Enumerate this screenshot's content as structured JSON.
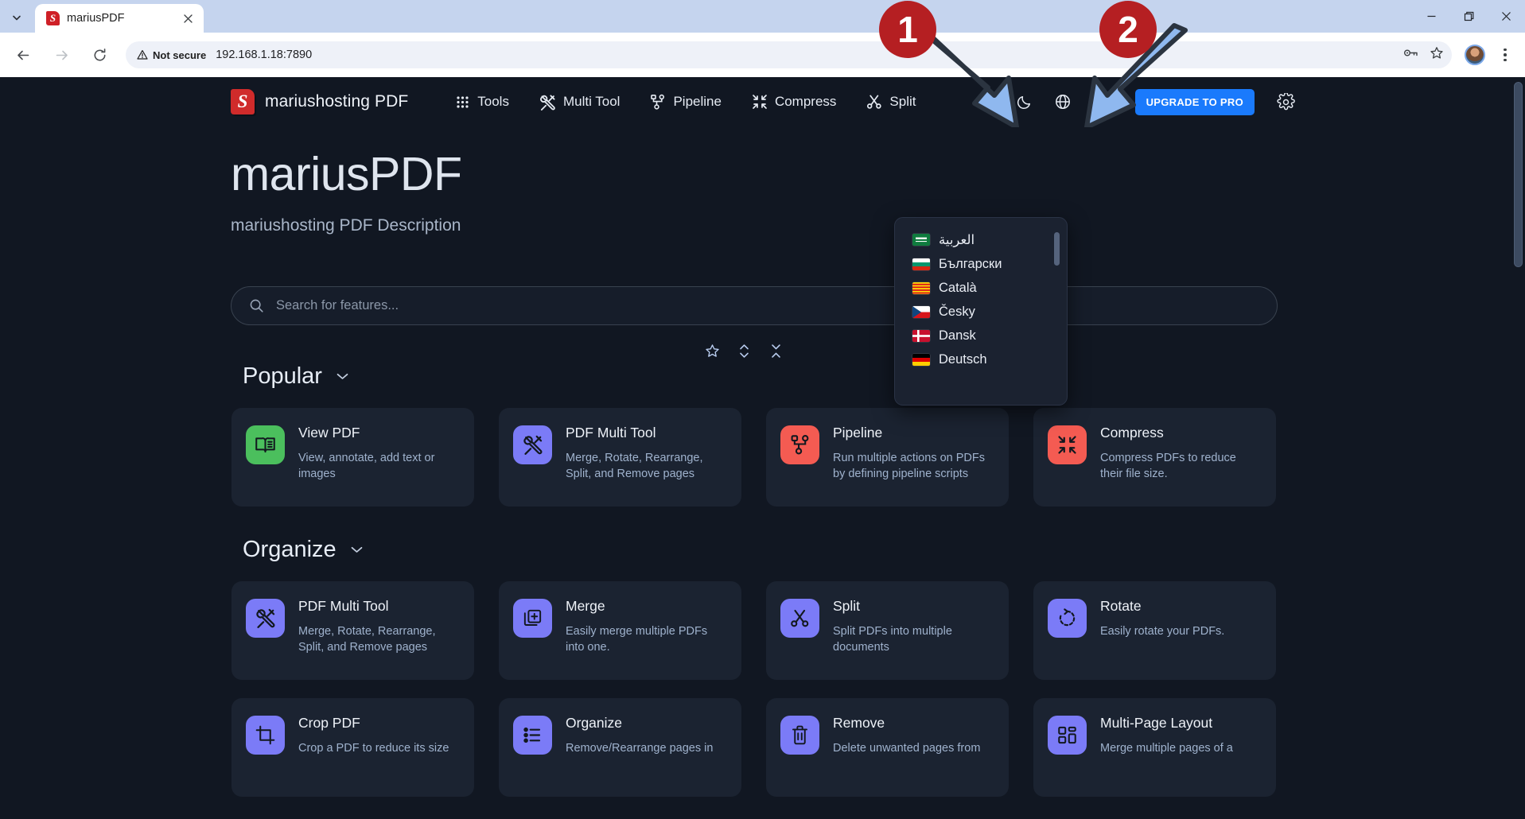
{
  "browser": {
    "tab": {
      "title": "mariusPDF",
      "favicon": "stirling-s-icon",
      "close_icon": "close-icon"
    },
    "tab_list_icon": "chevron-down-icon",
    "back_icon": "back-arrow-icon",
    "forward_icon": "forward-arrow-icon",
    "reload_icon": "reload-icon",
    "security": {
      "label": "Not secure",
      "icon": "warning-triangle-icon"
    },
    "url": "192.168.1.18:7890",
    "omnibox_icons": [
      "password-key-icon",
      "bookmark-star-icon"
    ],
    "profile_icon": "avatar",
    "menu_icon": "kebab-menu-icon",
    "window": {
      "minimize": "minimize-icon",
      "restore": "restore-icon",
      "close": "close-icon"
    }
  },
  "app": {
    "brand": {
      "name": "mariushosting PDF",
      "logo": "stirling-s-logo"
    },
    "nav": [
      {
        "label": "Tools",
        "icon": "grid-dots-icon"
      },
      {
        "label": "Multi Tool",
        "icon": "tools-hammer-wrench-icon"
      },
      {
        "label": "Pipeline",
        "icon": "pipeline-nodes-icon"
      },
      {
        "label": "Compress",
        "icon": "compress-arrows-icon"
      },
      {
        "label": "Split",
        "icon": "scissors-icon"
      }
    ],
    "actions": {
      "favorites_icon": "star-icon",
      "dark_mode_icon": "moon-icon",
      "language_icon": "globe-icon",
      "search_icon": "search-icon",
      "upgrade_label": "UPGRADE TO PRO",
      "settings_icon": "gear-icon"
    }
  },
  "language_menu": {
    "visible": true,
    "items": [
      {
        "label": "العربية",
        "flag": "sa",
        "rtl": true
      },
      {
        "label": "Български",
        "flag": "bg",
        "rtl": false
      },
      {
        "label": "Català",
        "flag": "cat",
        "rtl": false
      },
      {
        "label": "Česky",
        "flag": "cz",
        "rtl": false
      },
      {
        "label": "Dansk",
        "flag": "dk",
        "rtl": false
      },
      {
        "label": "Deutsch",
        "flag": "de",
        "rtl": false
      }
    ]
  },
  "hero": {
    "title": "mariusPDF",
    "subtitle": "mariushosting PDF Description"
  },
  "search": {
    "placeholder": "Search for features...",
    "icon": "search-icon",
    "value": ""
  },
  "section_tools": [
    {
      "icon": "star-icon",
      "name": "favorites-toggle"
    },
    {
      "icon": "expand-vertical-icon",
      "name": "expand-all-toggle"
    },
    {
      "icon": "collapse-vertical-icon",
      "name": "collapse-all-toggle"
    }
  ],
  "sections": [
    {
      "title": "Popular",
      "chevron": "chevron-down-icon",
      "cards": [
        {
          "title": "View PDF",
          "desc": "View, annotate, add text or images",
          "icon": "book-open-icon",
          "color": "#4bbf5d"
        },
        {
          "title": "PDF Multi Tool",
          "desc": "Merge, Rotate, Rearrange, Split, and Remove pages",
          "icon": "tools-hammer-wrench-icon",
          "color": "#7b7bf7"
        },
        {
          "title": "Pipeline",
          "desc": "Run multiple actions on PDFs by defining pipeline scripts",
          "icon": "pipeline-nodes-icon",
          "color": "#f45b52"
        },
        {
          "title": "Compress",
          "desc": "Compress PDFs to reduce their file size.",
          "icon": "compress-arrows-icon",
          "color": "#f45b52"
        }
      ]
    },
    {
      "title": "Organize",
      "chevron": "chevron-down-icon",
      "cards": [
        {
          "title": "PDF Multi Tool",
          "desc": "Merge, Rotate, Rearrange, Split, and Remove pages",
          "icon": "tools-hammer-wrench-icon",
          "color": "#7b7bf7"
        },
        {
          "title": "Merge",
          "desc": "Easily merge multiple PDFs into one.",
          "icon": "merge-plus-icon",
          "color": "#7b7bf7"
        },
        {
          "title": "Split",
          "desc": "Split PDFs into multiple documents",
          "icon": "scissors-icon",
          "color": "#7b7bf7"
        },
        {
          "title": "Rotate",
          "desc": "Easily rotate your PDFs.",
          "icon": "rotate-icon",
          "color": "#7b7bf7"
        }
      ]
    },
    {
      "title": "",
      "chevron": "",
      "cards": [
        {
          "title": "Crop PDF",
          "desc": "Crop a PDF to reduce its size",
          "icon": "crop-icon",
          "color": "#7b7bf7"
        },
        {
          "title": "Organize",
          "desc": "Remove/Rearrange pages in",
          "icon": "list-icon",
          "color": "#7b7bf7"
        },
        {
          "title": "Remove",
          "desc": "Delete unwanted pages from",
          "icon": "trash-icon",
          "color": "#7b7bf7"
        },
        {
          "title": "Multi-Page Layout",
          "desc": "Merge multiple pages of a",
          "icon": "layout-grid-icon",
          "color": "#7b7bf7"
        }
      ]
    }
  ],
  "annotations": [
    {
      "number": "1",
      "target": "dark-mode-icon"
    },
    {
      "number": "2",
      "target": "language-globe-icon"
    }
  ],
  "colors": {
    "page_bg": "#111722",
    "card_bg": "#1b2331",
    "accent_blue": "#1a7afc",
    "annotation_red": "#b51f22",
    "arrow_blue": "#8fb8ef"
  }
}
